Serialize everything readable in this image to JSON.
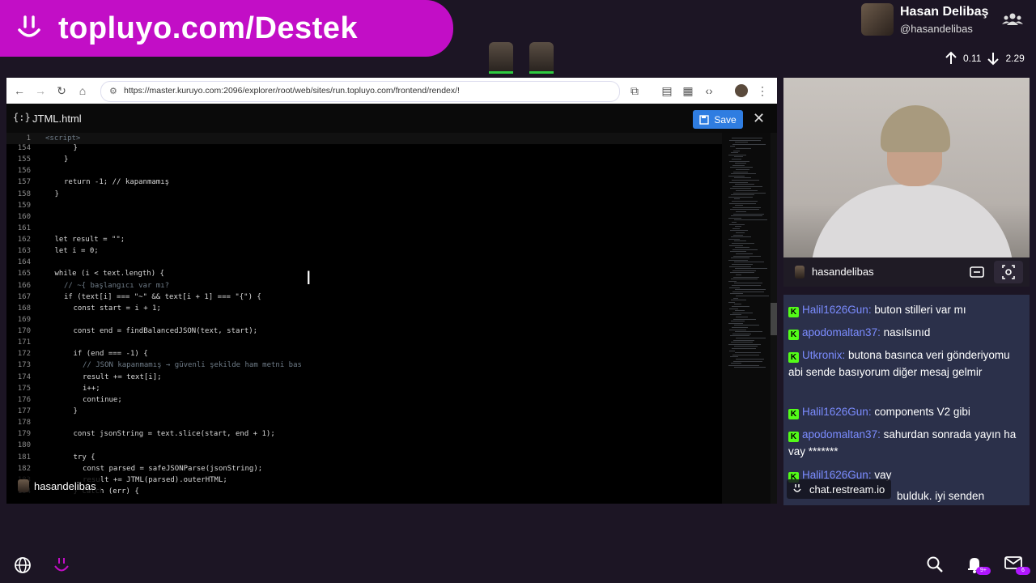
{
  "banner": {
    "text": "topluyo.com/Destek",
    "smile_icon": "smile-icon"
  },
  "streamer": {
    "name": "Hasan Delibaş",
    "handle": "@hasandelibas"
  },
  "stats": {
    "up": "0.11",
    "down": "2.29"
  },
  "browser": {
    "url": "https://master.kuruyo.com:2096/explorer/root/web/sites/run.topluyo.com/frontend/rendex/!"
  },
  "editor": {
    "file_icon": "{:}",
    "filename": "JTML.html",
    "save_label": "Save",
    "lines": [
      {
        "n": "1",
        "t": "<script>",
        "cls": "cm",
        "indent": 0
      },
      {
        "n": "154",
        "t": "}",
        "indent": 3
      },
      {
        "n": "155",
        "t": "}",
        "indent": 2
      },
      {
        "n": "156",
        "t": "",
        "indent": 0
      },
      {
        "n": "157",
        "t": "return -1; // kapanmamış",
        "indent": 2
      },
      {
        "n": "158",
        "t": "}",
        "indent": 1
      },
      {
        "n": "159",
        "t": "",
        "indent": 0
      },
      {
        "n": "160",
        "t": "",
        "indent": 0
      },
      {
        "n": "161",
        "t": "",
        "indent": 0
      },
      {
        "n": "162",
        "t": "let result = \"\";",
        "indent": 1
      },
      {
        "n": "163",
        "t": "let i = 0;",
        "indent": 1
      },
      {
        "n": "164",
        "t": "",
        "indent": 0
      },
      {
        "n": "165",
        "t": "while (i < text.length) {",
        "indent": 1
      },
      {
        "n": "166",
        "t": "// ~{ başlangıcı var mı?",
        "cls": "cm",
        "indent": 2
      },
      {
        "n": "167",
        "t": "if (text[i] === \"~\" && text[i + 1] === \"{\") {",
        "indent": 2
      },
      {
        "n": "168",
        "t": "const start = i + 1;",
        "indent": 3
      },
      {
        "n": "169",
        "t": "",
        "indent": 0
      },
      {
        "n": "170",
        "t": "const end = findBalancedJSON(text, start);",
        "indent": 3
      },
      {
        "n": "171",
        "t": "",
        "indent": 0
      },
      {
        "n": "172",
        "t": "if (end === -1) {",
        "indent": 3
      },
      {
        "n": "173",
        "t": "// JSON kapanmamış → güvenli şekilde ham metni bas",
        "cls": "cm",
        "indent": 4
      },
      {
        "n": "174",
        "t": "result += text[i];",
        "indent": 4
      },
      {
        "n": "175",
        "t": "i++;",
        "indent": 4
      },
      {
        "n": "176",
        "t": "continue;",
        "indent": 4
      },
      {
        "n": "177",
        "t": "}",
        "indent": 3
      },
      {
        "n": "178",
        "t": "",
        "indent": 0
      },
      {
        "n": "179",
        "t": "const jsonString = text.slice(start, end + 1);",
        "indent": 3
      },
      {
        "n": "180",
        "t": "",
        "indent": 0
      },
      {
        "n": "181",
        "t": "try {",
        "indent": 3
      },
      {
        "n": "182",
        "t": "const parsed = safeJSONParse(jsonString);",
        "indent": 4
      },
      {
        "n": "183",
        "t": "result += JTML(parsed).outerHTML;",
        "indent": 4
      },
      {
        "n": "184",
        "t": "} catch (err) {",
        "indent": 3
      }
    ]
  },
  "code_overlay_user": "hasandelibas",
  "webcam": {
    "name": "hasandelibas"
  },
  "chat": {
    "messages": [
      {
        "user": "Halil1626Gun",
        "text": "buton stilleri var mı"
      },
      {
        "user": "apodomaltan37",
        "text": "nasılsınıd"
      },
      {
        "user": "Utkronix",
        "text": "butona basınca veri gönderiyomu abi sende basıyorum diğer mesaj gelmir"
      },
      {
        "user": "Halil1626Gun",
        "text": "components V2 gibi"
      },
      {
        "user": "apodomaltan37",
        "text": "sahurdan sonrada yayın ha vay *******"
      },
      {
        "user": "Halil1626Gun",
        "text": "vay"
      },
      {
        "user": "",
        "text": "bulduk. iyi senden"
      }
    ],
    "footer": "chat.restream.io"
  },
  "bottom": {
    "bell_badge": "9+",
    "mail_badge": "6"
  }
}
